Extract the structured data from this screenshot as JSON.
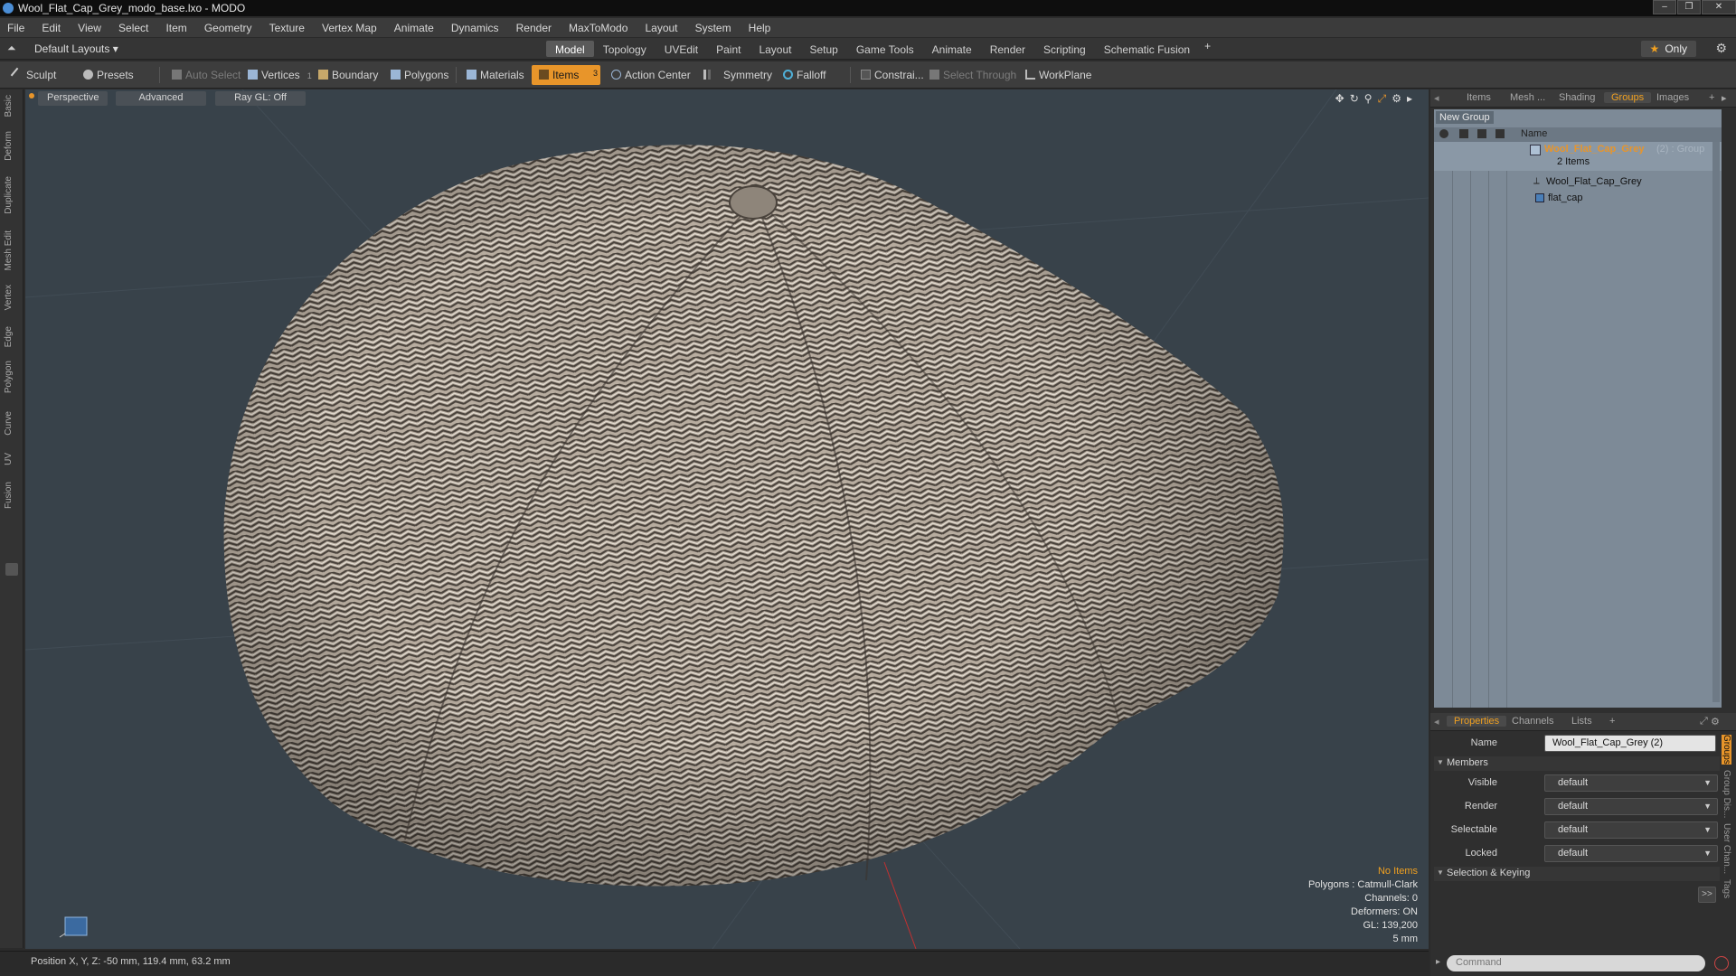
{
  "window": {
    "title": "Wool_Flat_Cap_Grey_modo_base.lxo - MODO",
    "controls": [
      "–",
      "❐",
      "✕"
    ]
  },
  "menu": [
    "File",
    "Edit",
    "View",
    "Select",
    "Item",
    "Geometry",
    "Texture",
    "Vertex Map",
    "Animate",
    "Dynamics",
    "Render",
    "MaxToModo",
    "Layout",
    "System",
    "Help"
  ],
  "layoutbar": {
    "layouts_label": "Default Layouts ▾",
    "tabs": [
      "Model",
      "Topology",
      "UVEdit",
      "Paint",
      "Layout",
      "Setup",
      "Game Tools",
      "Animate",
      "Render",
      "Scripting",
      "Schematic Fusion"
    ],
    "active_tab": "Model",
    "plus": "+",
    "only_label": "Only"
  },
  "toolbar": {
    "sculpt": "Sculpt",
    "presets": "Presets",
    "auto_select": "Auto Select",
    "vertices": "Vertices",
    "vertices_count": "1",
    "boundary": "Boundary",
    "polygons": "Polygons",
    "materials": "Materials",
    "items": "Items",
    "items_count": "3",
    "action_center": "Action Center",
    "symmetry": "Symmetry",
    "falloff": "Falloff",
    "constraints": "Constrai...",
    "select_through": "Select Through",
    "workplane": "WorkPlane",
    "accent_color": "#e8952a"
  },
  "left_tabs": [
    "Basic",
    "Deform",
    "Duplicate",
    "Mesh Edit",
    "Vertex",
    "Edge",
    "Polygon",
    "Curve",
    "UV",
    "Fusion"
  ],
  "viewport": {
    "view_mode": "Perspective",
    "shading": "Advanced",
    "raygl": "Ray GL: Off",
    "info": {
      "selection": "No Items",
      "polygons": "Polygons : Catmull-Clark",
      "channels": "Channels: 0",
      "deformers": "Deformers: ON",
      "gl": "GL: 139,200",
      "scale": "5 mm"
    },
    "model": "wool flat cap, grey herringbone texture"
  },
  "status": {
    "position": "Position X, Y, Z:  -50 mm, 119.4 mm, 63.2 mm"
  },
  "right_top": {
    "tabs": [
      "Items",
      "Mesh ...",
      "Shading",
      "Groups",
      "Images"
    ],
    "active_tab": "Groups",
    "new_group": "New Group",
    "col_name": "Name",
    "group": {
      "name": "Wool_Flat_Cap_Grey",
      "suffix": "(2) : Group",
      "count": "2 Items",
      "children": [
        "Wool_Flat_Cap_Grey",
        "flat_cap"
      ]
    }
  },
  "right_bottom": {
    "tabs": [
      "Properties",
      "Channels",
      "Lists"
    ],
    "active_tab": "Properties",
    "name_label": "Name",
    "name_value": "Wool_Flat_Cap_Grey (2)",
    "members_label": "Members",
    "fields": [
      {
        "label": "Visible",
        "value": "default"
      },
      {
        "label": "Render",
        "value": "default"
      },
      {
        "label": "Selectable",
        "value": "default"
      },
      {
        "label": "Locked",
        "value": "default"
      }
    ],
    "selection_keying": "Selection & Keying",
    "expand_btn": ">>",
    "side_tabs": [
      "Groups",
      "Group Dis...",
      "User Chan...",
      "Tags"
    ],
    "command_placeholder": "Command"
  }
}
